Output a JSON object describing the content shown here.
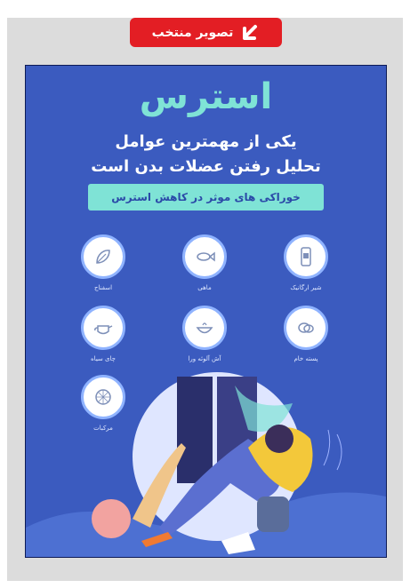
{
  "badge": {
    "label": "تصویر منتخب",
    "icon": "arrow-down-left-icon"
  },
  "poster": {
    "headline": "استرس",
    "subtitle_line1": "یکی از مهمترین عوامل",
    "subtitle_line2": "تحلیل رفتن عضلات بدن است",
    "banner": "خوراکی های موثر در کاهش استرس",
    "items": [
      {
        "label": "شیر ارگانیک",
        "icon": "milk-icon"
      },
      {
        "label": "ماهی",
        "icon": "fish-icon"
      },
      {
        "label": "اسفناج",
        "icon": "spinach-icon"
      },
      {
        "label": "پسته خام",
        "icon": "pistachio-icon"
      },
      {
        "label": "آش آلوئه ورا",
        "icon": "bowl-icon"
      },
      {
        "label": "چای سیاه",
        "icon": "teapot-icon"
      },
      {
        "label": "مرکبات",
        "icon": "citrus-icon"
      }
    ],
    "colors": {
      "background": "#3b5bbf",
      "accent": "#7fe3d6",
      "badge": "#e31e24"
    }
  }
}
